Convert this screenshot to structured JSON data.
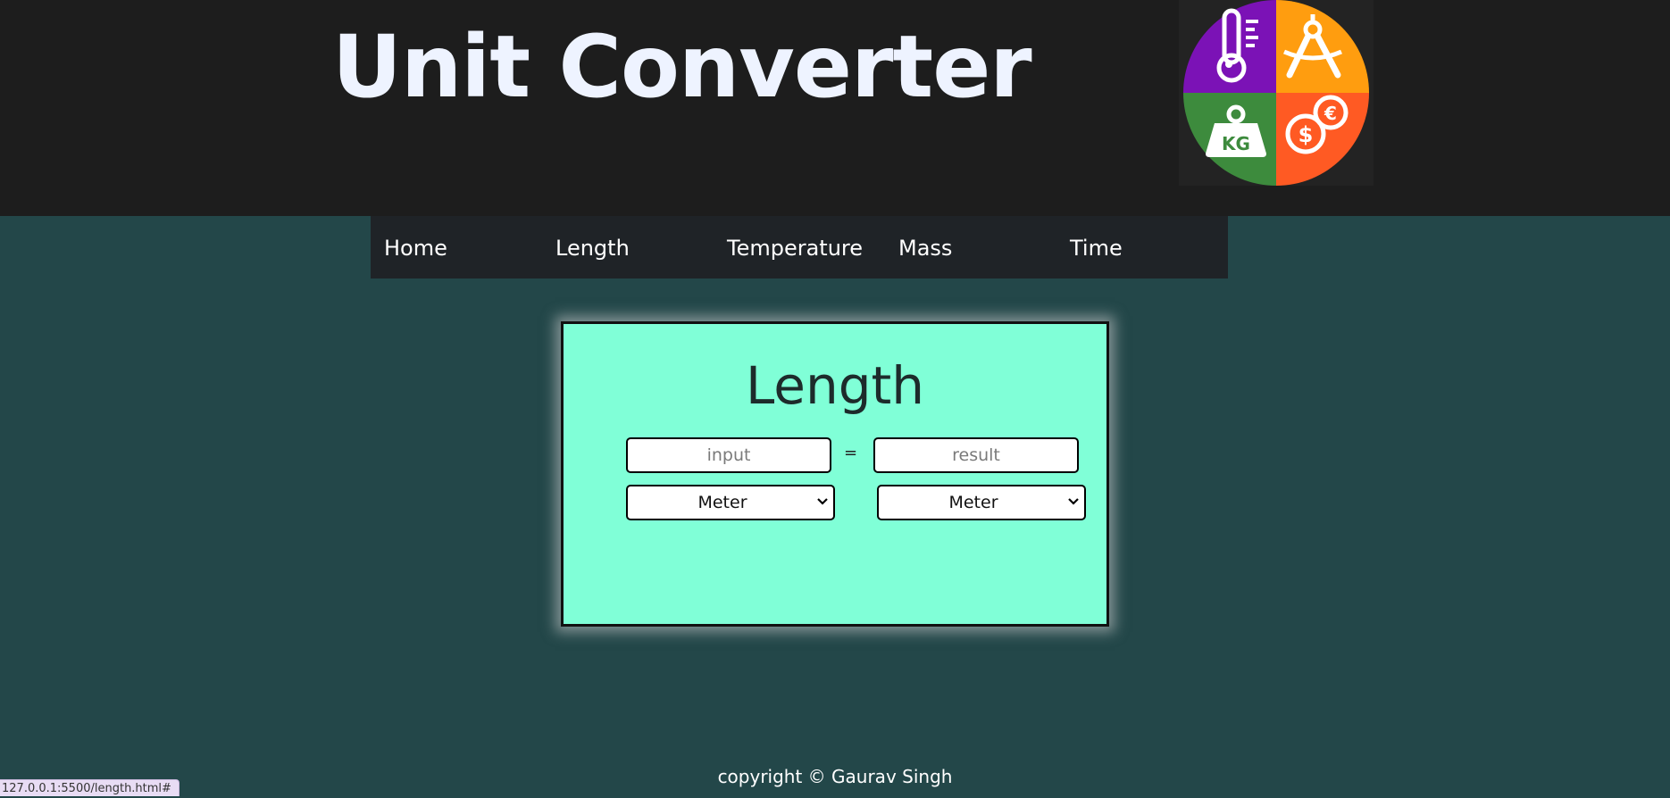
{
  "header": {
    "title": "Unit Converter",
    "logo": {
      "icon_names": [
        "thermometer-icon",
        "compass-icon",
        "weight-kg-icon",
        "currency-icon"
      ],
      "text": "KG",
      "colors": [
        "#7b12b6",
        "#ff9d0f",
        "#3d8b3d",
        "#ff5a23"
      ]
    }
  },
  "nav": {
    "items": [
      {
        "label": "Home"
      },
      {
        "label": "Length"
      },
      {
        "label": "Temperature"
      },
      {
        "label": "Mass"
      },
      {
        "label": "Time"
      }
    ]
  },
  "converter": {
    "title": "Length",
    "input_placeholder": "input",
    "result_placeholder": "result",
    "equals": "=",
    "from_unit": "Meter",
    "to_unit": "Meter"
  },
  "footer": {
    "copyright": "copyright © Gaurav Singh"
  },
  "status_bar": {
    "url": "127.0.0.1:5500/length.html#"
  },
  "colors": {
    "header_bg": "#1d1d1d",
    "page_bg": "#234749",
    "nav_bg": "#1f2327",
    "card_bg": "#80ffd7"
  }
}
